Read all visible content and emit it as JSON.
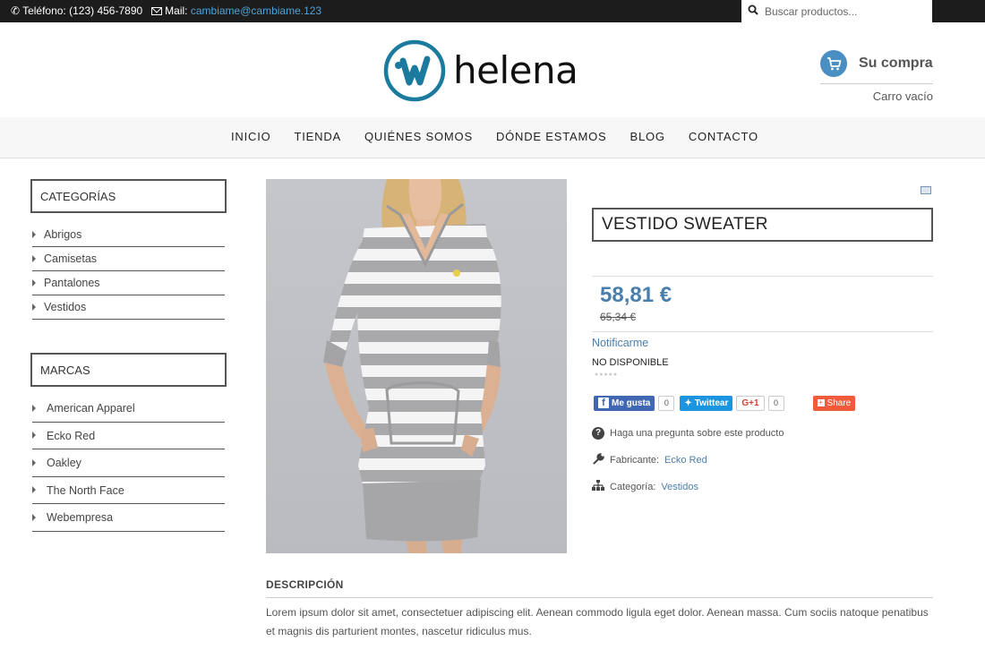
{
  "topbar": {
    "phone_label": "Teléfono: (123) 456-7890",
    "mail_label": "Mail:",
    "mail_value": "cambiame@cambiame.123",
    "search_placeholder": "Buscar productos..."
  },
  "header": {
    "logo_text": "helena",
    "cart_title": "Su compra",
    "cart_status": "Carro vacío"
  },
  "nav": {
    "items": [
      {
        "label": "INICIO"
      },
      {
        "label": "TIENDA"
      },
      {
        "label": "QUIÉNES SOMOS"
      },
      {
        "label": "DÓNDE ESTAMOS"
      },
      {
        "label": "BLOG"
      },
      {
        "label": "CONTACTO"
      }
    ]
  },
  "sidebar": {
    "categories": {
      "title": "CATEGORÍAS",
      "items": [
        {
          "label": "Abrigos"
        },
        {
          "label": "Camisetas"
        },
        {
          "label": "Pantalones"
        },
        {
          "label": "Vestidos"
        }
      ]
    },
    "brands": {
      "title": "MARCAS",
      "items": [
        {
          "label": "American Apparel"
        },
        {
          "label": "Ecko Red"
        },
        {
          "label": "Oakley"
        },
        {
          "label": "The North Face"
        },
        {
          "label": "Webempresa"
        }
      ]
    }
  },
  "product": {
    "title": "VESTIDO SWEATER",
    "price": "58,81 €",
    "old_price": "65,34 €",
    "notify_label": "Notificarme",
    "availability": "NO DISPONIBLE",
    "ask_question": "Haga una pregunta sobre este producto",
    "manufacturer_label": "Fabricante:",
    "manufacturer_value": "Ecko Red",
    "category_label": "Categoría:",
    "category_value": "Vestidos"
  },
  "social": {
    "facebook_label": "Me gusta",
    "facebook_count": "0",
    "twitter_label": "Twittear",
    "gplus_label": "G+1",
    "gplus_count": "0",
    "share_label": "Share"
  },
  "description": {
    "heading": "DESCRIPCIÓN",
    "text": "Lorem ipsum dolor sit amet, consectetuer adipiscing elit. Aenean commodo ligula eget dolor. Aenean massa. Cum sociis natoque penatibus et magnis dis parturient montes, nascetur ridiculus mus."
  },
  "colors": {
    "accent_blue": "#4a7fad",
    "logo_teal": "#1b7a9e",
    "topbar_bg": "#1c1c1c"
  }
}
